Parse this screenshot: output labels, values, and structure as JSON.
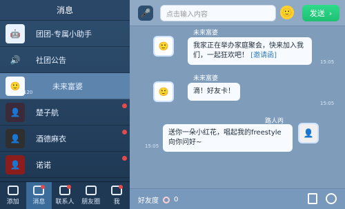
{
  "left_panel": {
    "title": "消息",
    "items": [
      {
        "label": "团团-专属小助手",
        "icon": "robot-icon",
        "unread": false
      },
      {
        "label": "社团公告",
        "icon": "speaker-icon",
        "unread": false
      },
      {
        "label": "未来富婆",
        "icon": "group-icon",
        "unread": false,
        "active": true,
        "badge": "120"
      },
      {
        "label": "楚子航",
        "icon": "character-icon",
        "unread": true
      },
      {
        "label": "酒德麻衣",
        "icon": "character-icon",
        "unread": true
      },
      {
        "label": "诺诺",
        "icon": "character-icon",
        "unread": true
      }
    ]
  },
  "nav": {
    "items": [
      {
        "label": "添加",
        "icon": "add-icon",
        "active": false,
        "dot": false
      },
      {
        "label": "消息",
        "icon": "mail-icon",
        "active": true,
        "dot": true
      },
      {
        "label": "联系人",
        "icon": "contacts-icon",
        "active": false,
        "dot": true
      },
      {
        "label": "朋友圈",
        "icon": "moments-icon",
        "active": false,
        "dot": false
      },
      {
        "label": "我",
        "icon": "user-icon",
        "active": false,
        "dot": true
      }
    ]
  },
  "chat": {
    "input_placeholder": "点击输入内容",
    "send_label": "发送",
    "messages": [
      {
        "sender": "未来富婆",
        "text": "我家正在举办家庭聚会，快来加入我们，一起狂欢吧！",
        "link": "[邀请函]",
        "time": "15:05"
      },
      {
        "sender": "未来富婆",
        "text": "滴！好友卡！",
        "time": "15:05"
      },
      {
        "sender": "路人丙",
        "text": "送你一朵小红花，唱起我的freestyle向你问好~",
        "time": "15:05"
      }
    ],
    "footer": {
      "friend_label": "好友度",
      "friend_value": "0"
    }
  }
}
